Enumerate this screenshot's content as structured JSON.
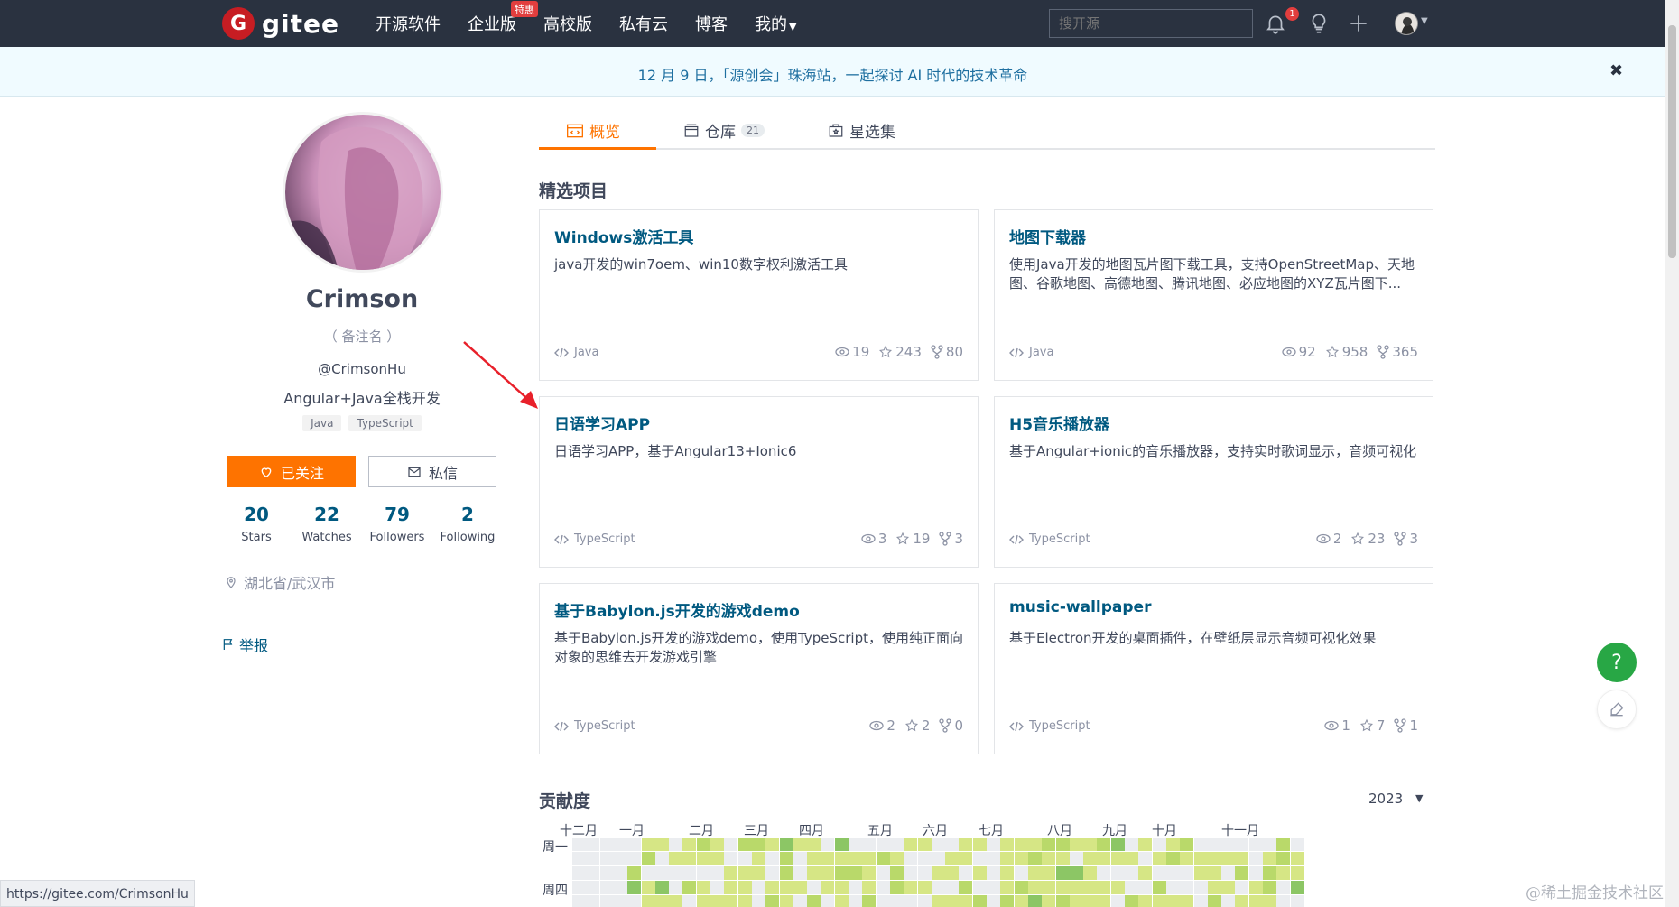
{
  "nav": {
    "logo_text": "gitee",
    "items": [
      {
        "label": "开源软件"
      },
      {
        "label": "企业版",
        "badge": "特惠"
      },
      {
        "label": "高校版"
      },
      {
        "label": "私有云"
      },
      {
        "label": "博客"
      },
      {
        "label": "我的"
      }
    ],
    "search_placeholder": "搜开源",
    "bell_count": "1"
  },
  "banner": {
    "text": "12 月 9 日，「源创会」珠海站，一起探讨 AI 时代的技术革命",
    "close": "✖"
  },
  "profile": {
    "name": "Crimson",
    "remark": "（ 备注名 ）",
    "handle": "@CrimsonHu",
    "bio": "Angular+Java全栈开发",
    "tags": [
      "Java",
      "TypeScript"
    ],
    "follow_label": "已关注",
    "message_label": "私信",
    "stats": [
      {
        "num": "20",
        "label": "Stars"
      },
      {
        "num": "22",
        "label": "Watches"
      },
      {
        "num": "79",
        "label": "Followers"
      },
      {
        "num": "2",
        "label": "Following"
      }
    ],
    "location": "湖北省/武汉市",
    "report": "举报"
  },
  "tabs": [
    {
      "label": "概览",
      "active": true
    },
    {
      "label": "仓库",
      "count": "21"
    },
    {
      "label": "星选集"
    }
  ],
  "featured_title": "精选项目",
  "projects": [
    {
      "title": "Windows激活工具",
      "desc": "java开发的win7oem、win10数字权利激活工具",
      "lang": "Java",
      "watch": "19",
      "star": "243",
      "fork": "80"
    },
    {
      "title": "地图下载器",
      "desc": "使用Java开发的地图瓦片图下载工具，支持OpenStreetMap、天地图、谷歌地图、高德地图、腾讯地图、必应地图的XYZ瓦片图下...",
      "lang": "Java",
      "watch": "92",
      "star": "958",
      "fork": "365"
    },
    {
      "title": "日语学习APP",
      "desc": "日语学习APP，基于Angular13+Ionic6",
      "lang": "TypeScript",
      "watch": "3",
      "star": "19",
      "fork": "3"
    },
    {
      "title": "H5音乐播放器",
      "desc": "基于Angular+ionic的音乐播放器，支持实时歌词显示，音频可视化",
      "lang": "TypeScript",
      "watch": "2",
      "star": "23",
      "fork": "3"
    },
    {
      "title": "基于Babylon.js开发的游戏demo",
      "desc": "基于Babylon.js开发的游戏demo，使用TypeScript，使用纯正面向对象的思维去开发游戏引擎",
      "lang": "TypeScript",
      "watch": "2",
      "star": "2",
      "fork": "0"
    },
    {
      "title": "music-wallpaper",
      "desc": "基于Electron开发的桌面插件，在壁纸层显示音频可视化效果",
      "lang": "TypeScript",
      "watch": "1",
      "star": "7",
      "fork": "1"
    }
  ],
  "contribution": {
    "title": "贡献度",
    "year": "2023",
    "months": [
      "十二月",
      "一月",
      "二月",
      "三月",
      "四月",
      "五月",
      "六月",
      "七月",
      "八月",
      "九月",
      "十月",
      "十一月"
    ],
    "weekdays": [
      "周一",
      "周四"
    ],
    "colors": {
      "empty": "#ebedf0",
      "level1": "#d6e685",
      "level2": "#b9d96a",
      "level3": "#8cc665"
    }
  },
  "floating": {
    "help": "?"
  },
  "status_url": "https://gitee.com/CrimsonHu",
  "watermark": "@稀土掘金技术社区"
}
